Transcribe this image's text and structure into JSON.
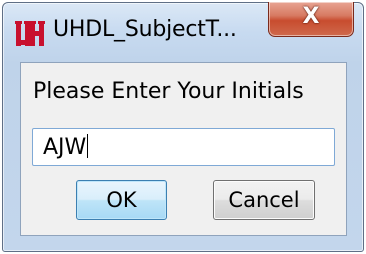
{
  "window": {
    "title": "UHDL_SubjectT...",
    "icon": "uh-logo-icon",
    "close_label": "X"
  },
  "dialog": {
    "prompt": "Please Enter Your Initials",
    "input_value": "AJW",
    "ok_label": "OK",
    "cancel_label": "Cancel"
  },
  "colors": {
    "logo_red": "#c8102e",
    "frame": "#c3d6ec",
    "close_button": "#c84c2f",
    "default_button_border": "#3c7fb1",
    "input_focus_border": "#7fa9d6"
  }
}
